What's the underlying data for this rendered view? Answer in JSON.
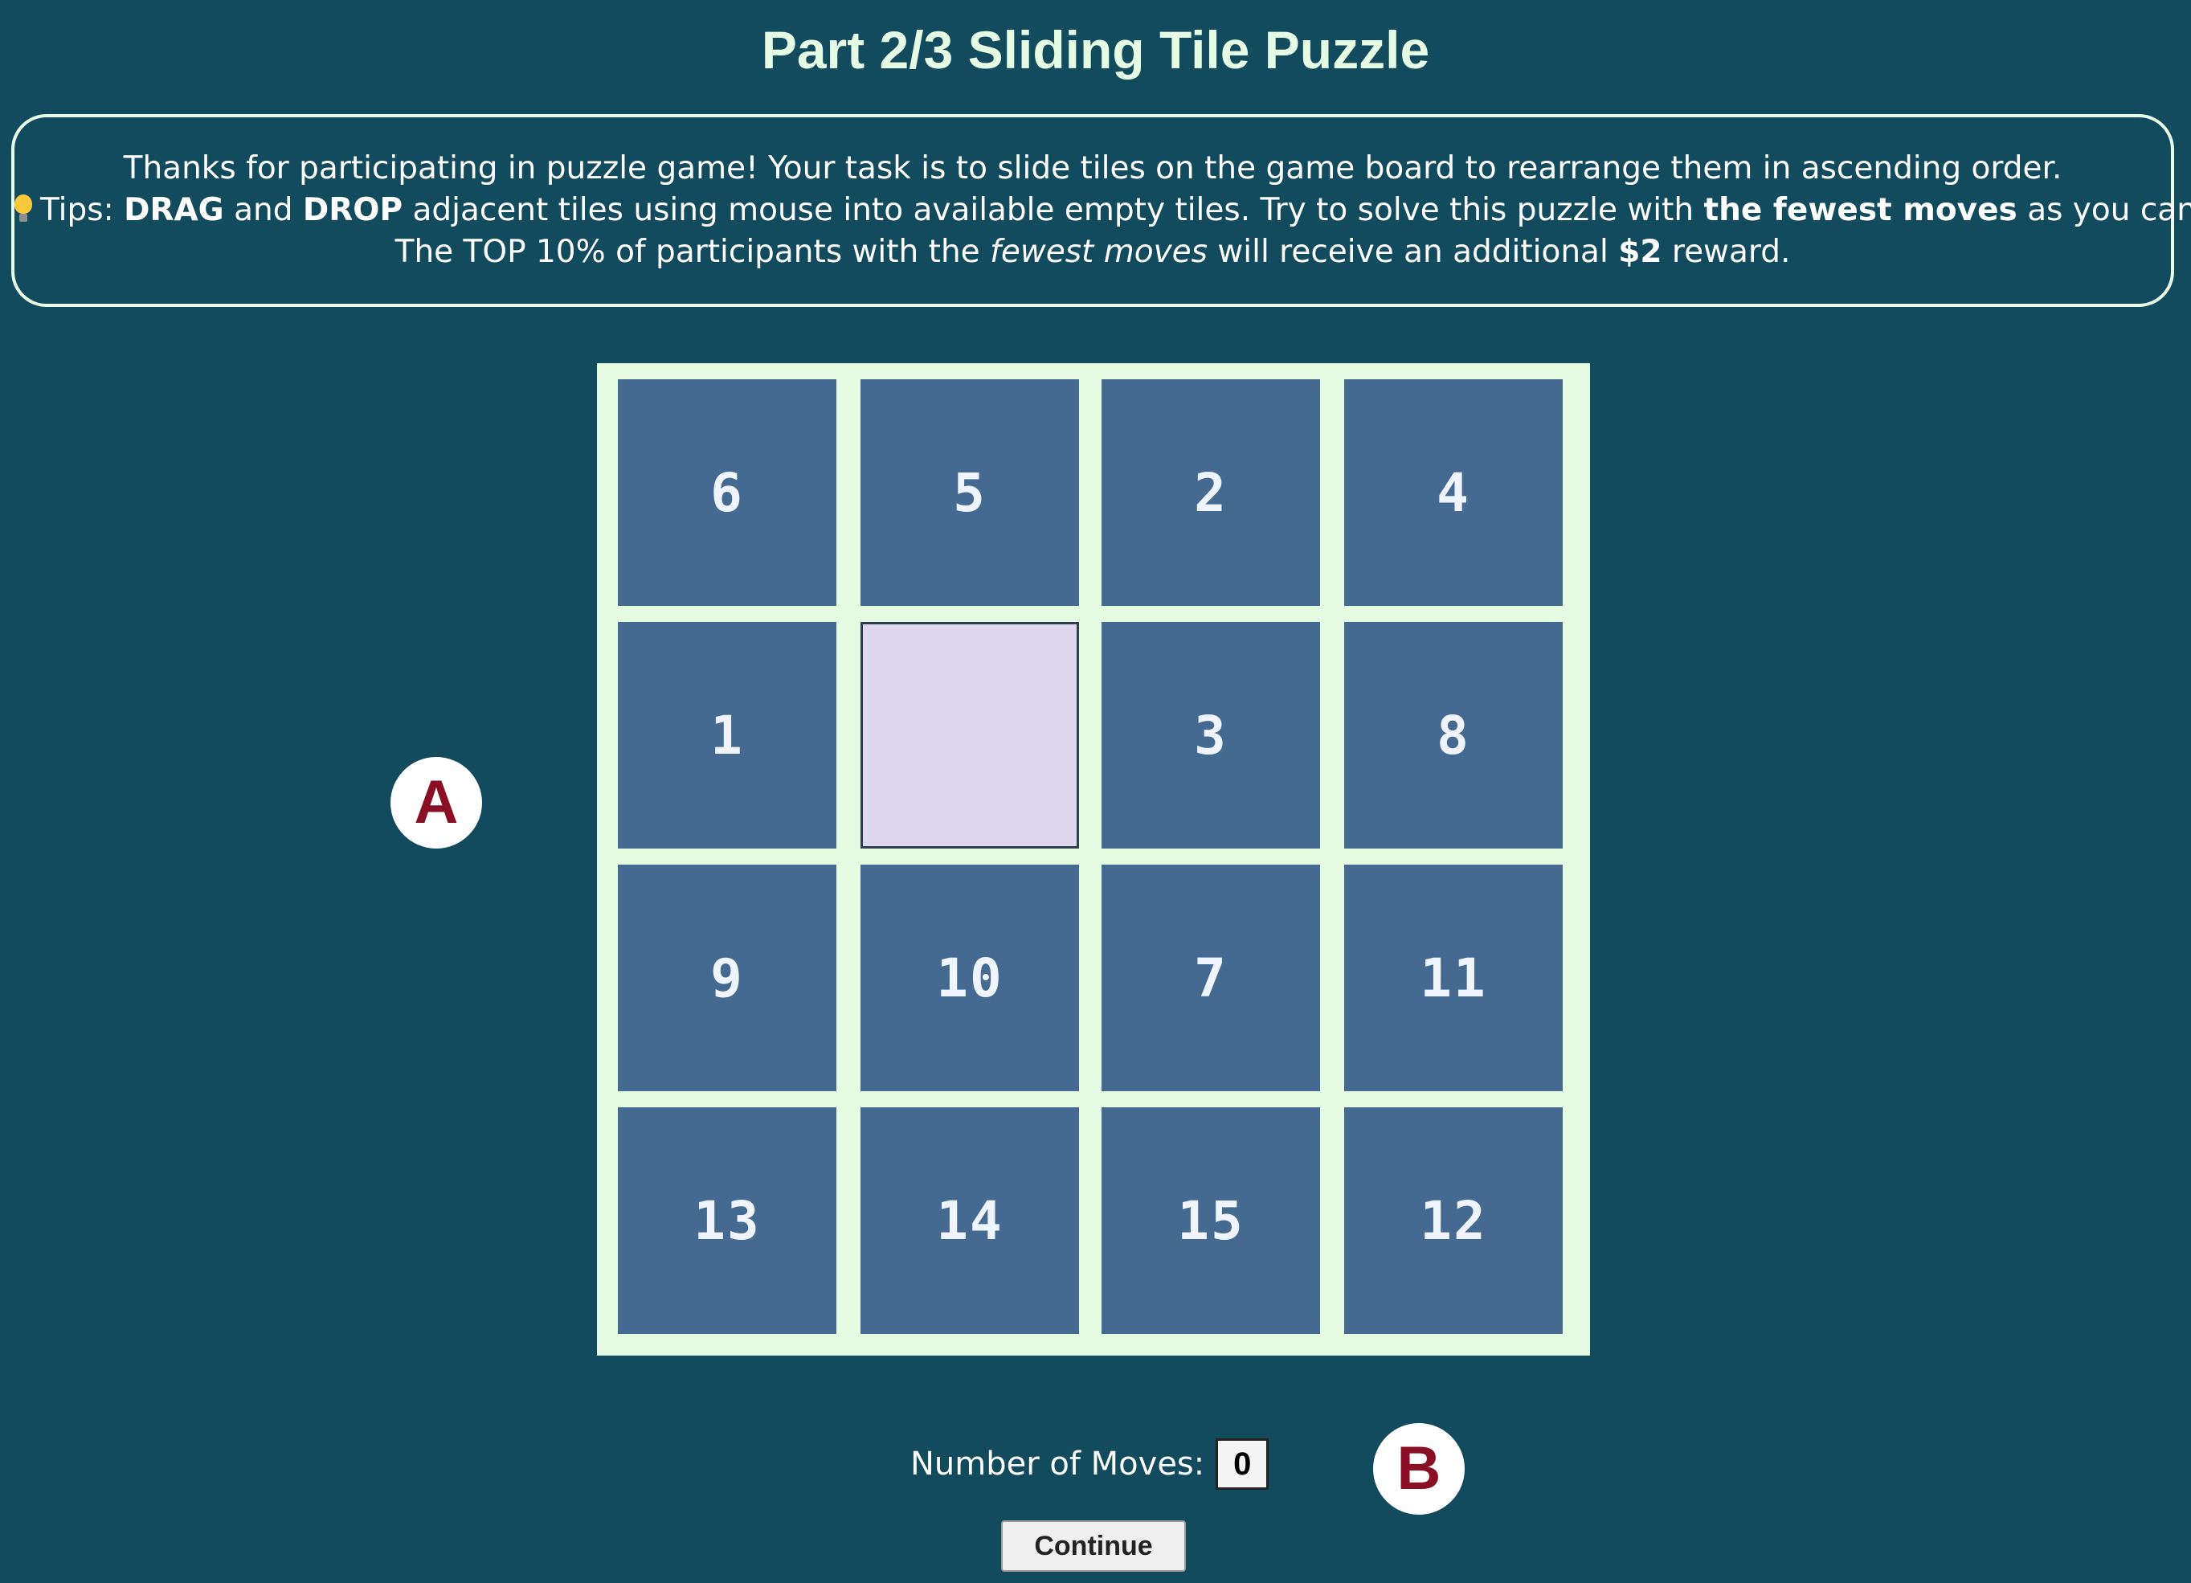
{
  "title": "Part 2/3 Sliding Tile Puzzle",
  "instructions": {
    "line1": "Thanks for participating in puzzle game! Your task is to slide tiles on the game board to rearrange them in ascending order.",
    "line2": {
      "tips_label": "Tips:",
      "drag": "DRAG",
      "and": "and",
      "drop": "DROP",
      "middle": "adjacent tiles using mouse into available empty tiles. Try to solve this puzzle with",
      "fewest": "the fewest moves",
      "end": "as you can."
    },
    "line3": {
      "start": "The TOP 10% of participants with the",
      "fewest_moves": "fewest moves",
      "middle": "will receive an additional",
      "amount": "$2",
      "end": "reward."
    }
  },
  "board": {
    "tiles": [
      "6",
      "5",
      "2",
      "4",
      "1",
      "",
      "3",
      "8",
      "9",
      "10",
      "7",
      "11",
      "13",
      "14",
      "15",
      "12"
    ]
  },
  "markers": {
    "a": "A",
    "b": "B"
  },
  "moves": {
    "label": "Number of Moves:",
    "value": "0"
  },
  "continue_button": "Continue",
  "colors": {
    "background": "#124a5e",
    "board": "#e4fbe2",
    "tile": "#456a91",
    "empty_tile": "#ddd6ec",
    "marker_text": "#8b0f24"
  }
}
